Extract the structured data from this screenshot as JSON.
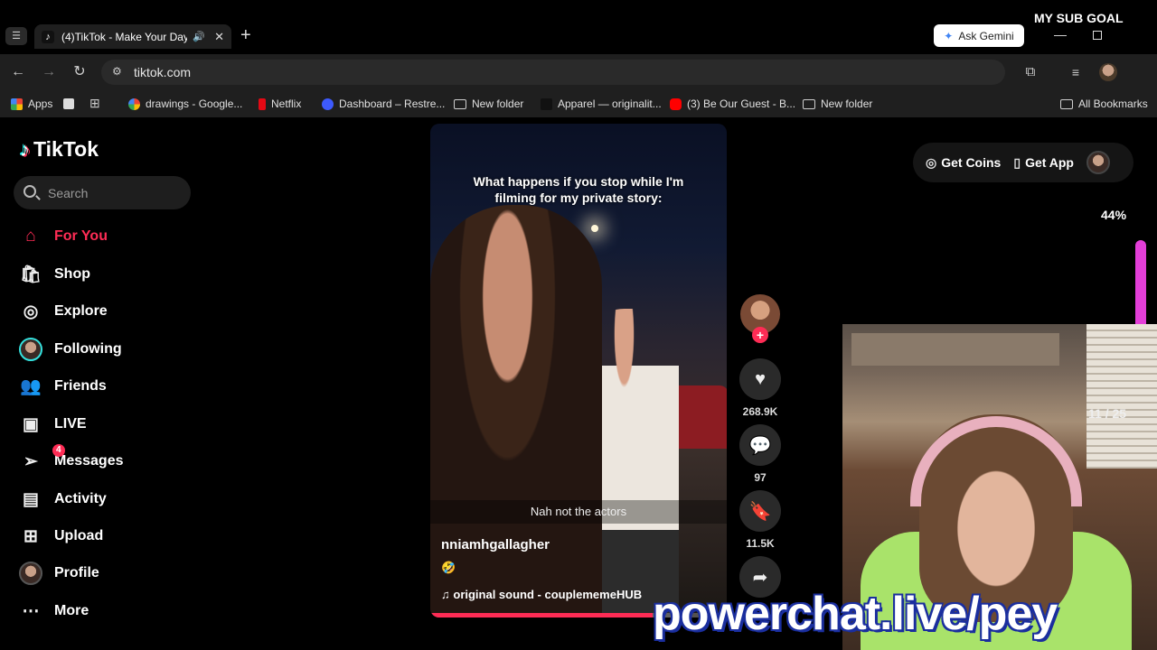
{
  "browser": {
    "tab_title": "(4)TikTok - Make Your Day",
    "new_tab": "+",
    "address": "tiktok.com",
    "ask_gemini": "Ask Gemini",
    "bookmarks": [
      {
        "label": "Apps",
        "color": "#f4b400"
      },
      {
        "label": "drawings - Google...",
        "color": "#4285f4"
      },
      {
        "label": "Netflix",
        "color": "#e50914"
      },
      {
        "label": "Dashboard – Restre...",
        "color": "#3d5afe"
      },
      {
        "label": "New folder",
        "color": ""
      },
      {
        "label": "Apparel — originalit...",
        "color": ""
      },
      {
        "label": "(3) Be Our Guest - B...",
        "color": "#ff0000"
      },
      {
        "label": "New folder",
        "color": ""
      },
      {
        "label": "All Bookmarks",
        "color": ""
      }
    ]
  },
  "tiktok": {
    "logo": "TikTok",
    "search_placeholder": "Search",
    "nav": [
      {
        "label": "For You",
        "icon": "home-icon",
        "active": true
      },
      {
        "label": "Shop",
        "icon": "shop-icon"
      },
      {
        "label": "Explore",
        "icon": "compass-icon"
      },
      {
        "label": "Following",
        "icon": "following-avatar-icon"
      },
      {
        "label": "Friends",
        "icon": "friends-icon"
      },
      {
        "label": "LIVE",
        "icon": "live-icon"
      },
      {
        "label": "Messages",
        "icon": "messages-icon",
        "badge": "4"
      },
      {
        "label": "Activity",
        "icon": "activity-icon"
      },
      {
        "label": "Upload",
        "icon": "upload-icon"
      },
      {
        "label": "Profile",
        "icon": "profile-avatar-icon"
      },
      {
        "label": "More",
        "icon": "more-icon"
      }
    ],
    "get_coins": "Get Coins",
    "get_app": "Get App",
    "percent": "44%",
    "video": {
      "caption": "What happens if you stop while I'm filming for my private story:",
      "subtitle": "Nah not the actors",
      "username": "nniamhgallagher",
      "sound": "original sound - couplememeHUB",
      "progress": 0.75
    },
    "actions": {
      "likes": "268.9K",
      "comments": "97",
      "saves": "11.5K"
    }
  },
  "stream_overlay": {
    "sub_goal": "MY SUB GOAL",
    "counter": "11 / 25",
    "watermark": "powerchat.live/pey"
  },
  "colors": {
    "accent": "#fe2c55",
    "rail": "#e33ed8"
  }
}
